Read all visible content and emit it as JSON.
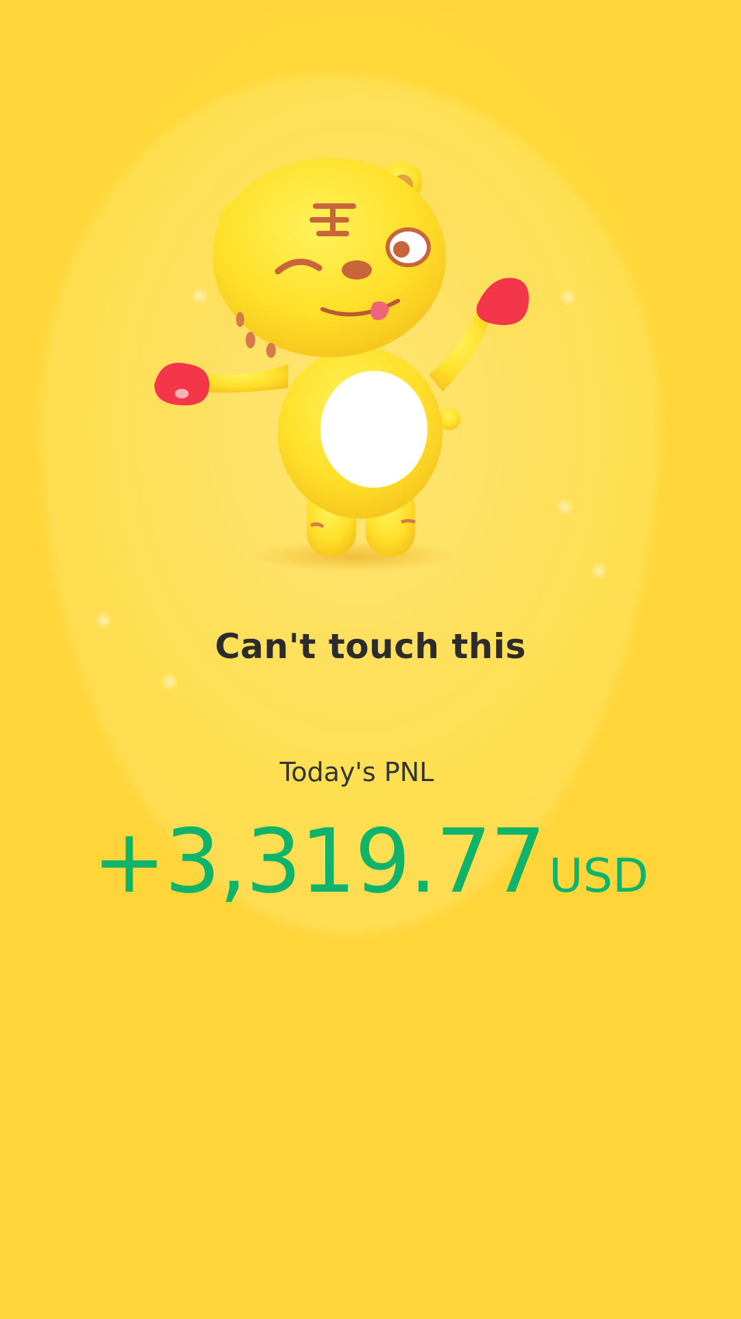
{
  "headline": "Can't touch this",
  "pnl": {
    "label": "Today's PNL",
    "value": "+3,319.77",
    "currency": "USD"
  },
  "colors": {
    "background": "#ffd93a",
    "headline_text": "#2c2c2c",
    "pnl_positive": "#0fb46a"
  },
  "mascot": {
    "icon": "tiger-mascot-icon"
  }
}
